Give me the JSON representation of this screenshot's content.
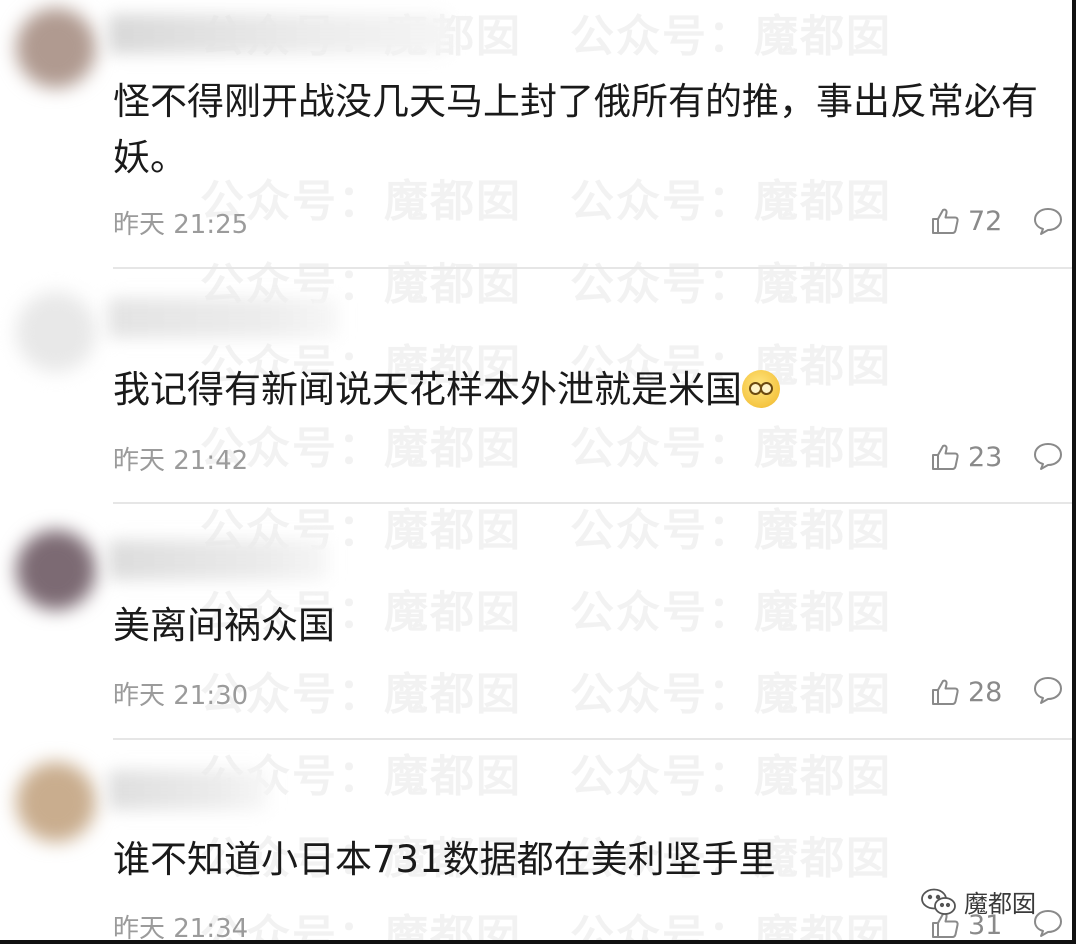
{
  "watermark_text": "公众号：魔都囡",
  "brand": {
    "label": "魔都囡"
  },
  "comments": [
    {
      "text": "怪不得刚开战没几天马上封了俄所有的推，事出反常必有妖。",
      "time": "昨天 21:25",
      "likes": "72",
      "avatar_color": "#b09a90"
    },
    {
      "text": "我记得有新闻说天花样本外泄就是米国",
      "time": "昨天 21:42",
      "likes": "23",
      "avatar_color": "#e8e8e8"
    },
    {
      "text": "美离间祸众国",
      "time": "昨天 21:30",
      "likes": "28",
      "avatar_color": "#7c6a73"
    },
    {
      "text": "谁不知道小日本731数据都在美利坚手里",
      "time": "昨天 21:34",
      "likes": "31",
      "avatar_color": "#c9ad8e"
    }
  ],
  "icons": {
    "like": "thumbs-up-icon",
    "reply": "speech-bubble-icon",
    "emoji": "grinning-face-emoji",
    "brand": "wechat-icon"
  }
}
